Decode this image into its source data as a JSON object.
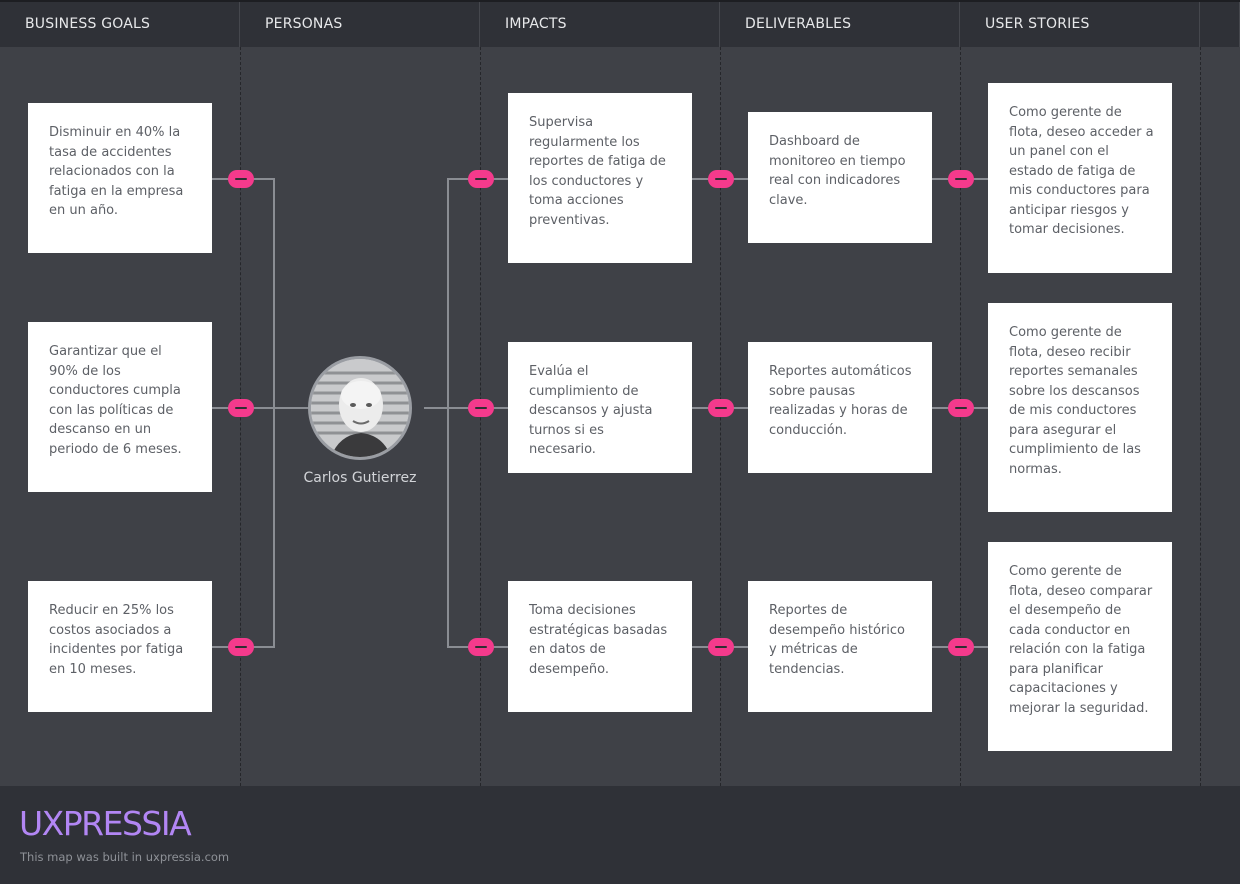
{
  "columns": [
    "BUSINESS GOALS",
    "PERSONAS",
    "IMPACTS",
    "DELIVERABLES",
    "USER STORIES"
  ],
  "business_goals": [
    "Disminuir en 40% la tasa de accidentes relacionados con la fatiga en la empresa en un año.",
    "Garantizar que el 90% de los conductores cumpla con las políticas de descanso en un periodo de 6 meses.",
    "Reducir en 25% los costos asociados a incidentes por fatiga en 10 meses."
  ],
  "persona": {
    "name": "Carlos Gutierrez"
  },
  "impacts": [
    "Supervisa regularmente los reportes de fatiga de los conductores y toma acciones preventivas.",
    "Evalúa el cumplimiento de descansos y ajusta turnos si es necesario.",
    "Toma decisiones estratégicas basadas en datos de desempeño."
  ],
  "deliverables": [
    "Dashboard de monitoreo en tiempo real con indicadores clave.",
    "Reportes automáticos sobre pausas realizadas y horas de conducción.",
    "Reportes de desempeño histórico y métricas de tendencias."
  ],
  "user_stories": [
    "Como gerente de flota, deseo acceder a un panel con el estado de fatiga de mis conductores para anticipar riesgos y tomar decisiones.",
    "Como gerente de flota, deseo recibir reportes semanales sobre los descansos de mis conductores para asegurar el cumplimiento de las normas.",
    "Como gerente de flota, deseo comparar el desempeño de cada conductor en relación con la fatiga para planificar capacitaciones y mejorar la seguridad."
  ],
  "footer": {
    "logo": "UXPRESSIA",
    "note": "This map was built in uxpressia.com"
  },
  "colors": {
    "accent": "#f43a8c",
    "logo": "#b286f4",
    "background": "#3f4147",
    "header": "#2f3137"
  }
}
